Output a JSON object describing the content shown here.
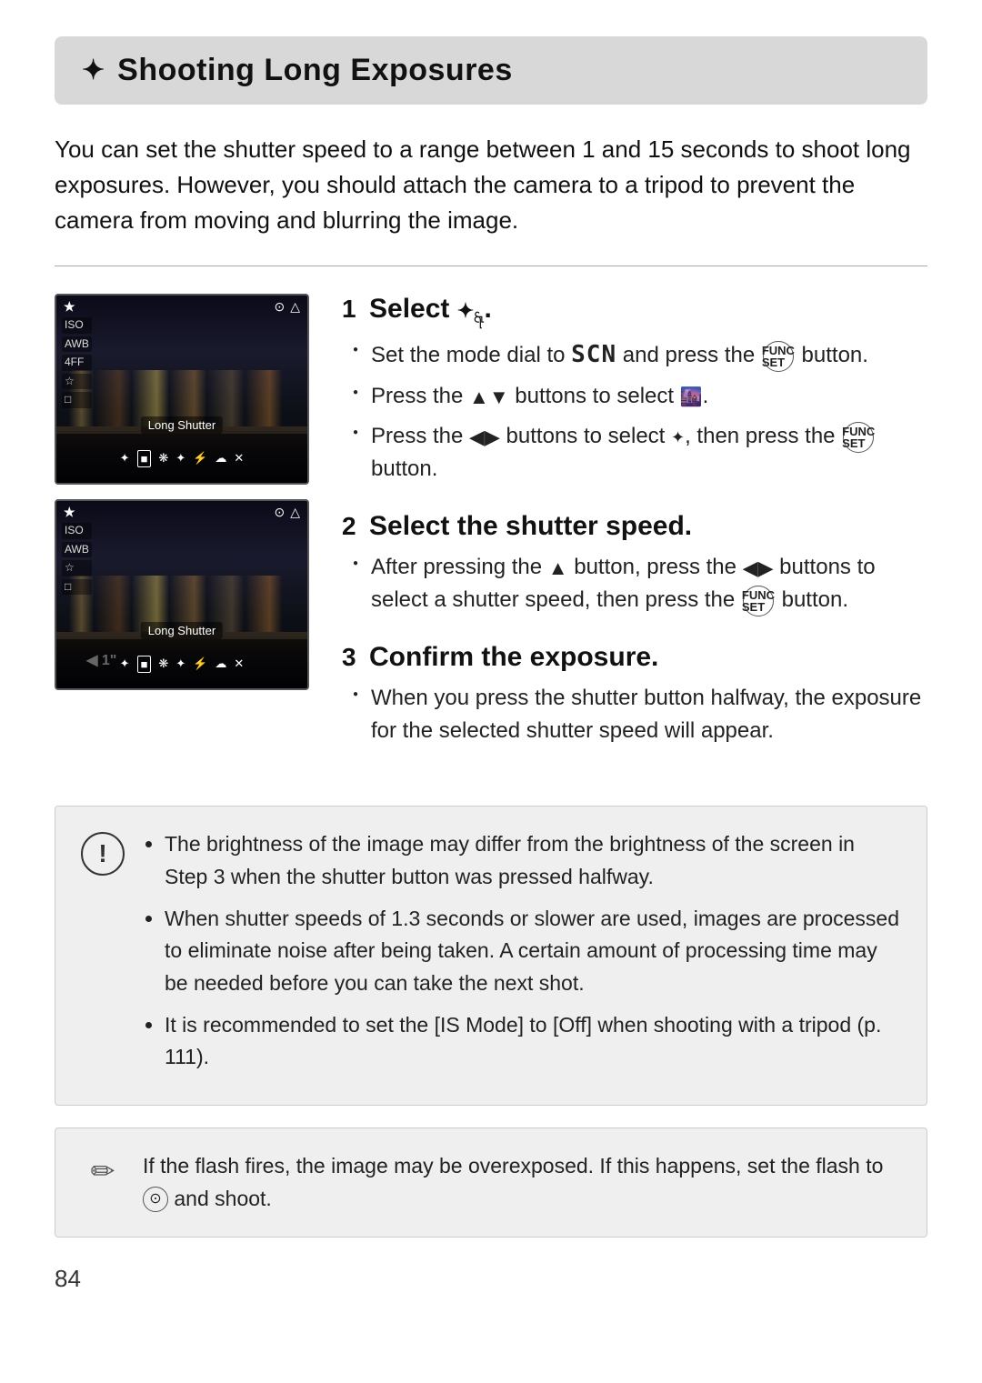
{
  "page": {
    "number": "84"
  },
  "header": {
    "icon": "✦",
    "title": "Shooting Long Exposures"
  },
  "intro": "You can set the shutter speed to a range between 1 and 15 seconds to shoot long exposures. However, you should attach the camera to a tripod to prevent the camera from moving and blurring the image.",
  "steps": [
    {
      "number": "1",
      "title": "Select ✦꩷.",
      "title_plain": "Select",
      "bullets": [
        "Set the mode dial to SCN and press the FUNC/SET button.",
        "Press the ▲▼ buttons to select 🌆.",
        "Press the ◀▶ buttons to select ✦꩷, then press the FUNC/SET button."
      ]
    },
    {
      "number": "2",
      "title": "Select the shutter speed.",
      "bullets": [
        "After pressing the ▲ button, press the ◀▶ buttons to select a shutter speed, then press the FUNC/SET button."
      ]
    },
    {
      "number": "3",
      "title": "Confirm the exposure.",
      "bullets": [
        "When you press the shutter button halfway, the exposure for the selected shutter speed will appear."
      ]
    }
  ],
  "camera1": {
    "label": "Long Shutter",
    "left_icons": [
      "★",
      "ISO",
      "AWB",
      "4FF",
      "☆",
      "□"
    ],
    "top_right": [
      "⊙",
      "△"
    ]
  },
  "camera2": {
    "label": "Long Shutter",
    "shutter": "◀ 1\""
  },
  "notice": {
    "icon": "!",
    "bullets": [
      "The brightness of the image may differ from the brightness of the screen in Step 3 when the shutter button was pressed halfway.",
      "When shutter speeds of 1.3 seconds or slower are used, images are processed to eliminate noise after being taken. A certain amount of processing time may be needed before you can take the next shot.",
      "It is recommended to set the [IS Mode] to [Off] when shooting with a tripod (p. 111)."
    ]
  },
  "tip": {
    "text": "If the flash fires, the image may be overexposed. If this happens, set the flash to ⊙ and shoot."
  },
  "bottom_icons_screen1": [
    "✦",
    "■",
    "❋",
    "✦",
    "⚡",
    "☁",
    "✕"
  ],
  "bottom_icons_screen2": [
    "✦",
    "■",
    "❋",
    "✦",
    "⚡",
    "☁",
    "✕"
  ]
}
